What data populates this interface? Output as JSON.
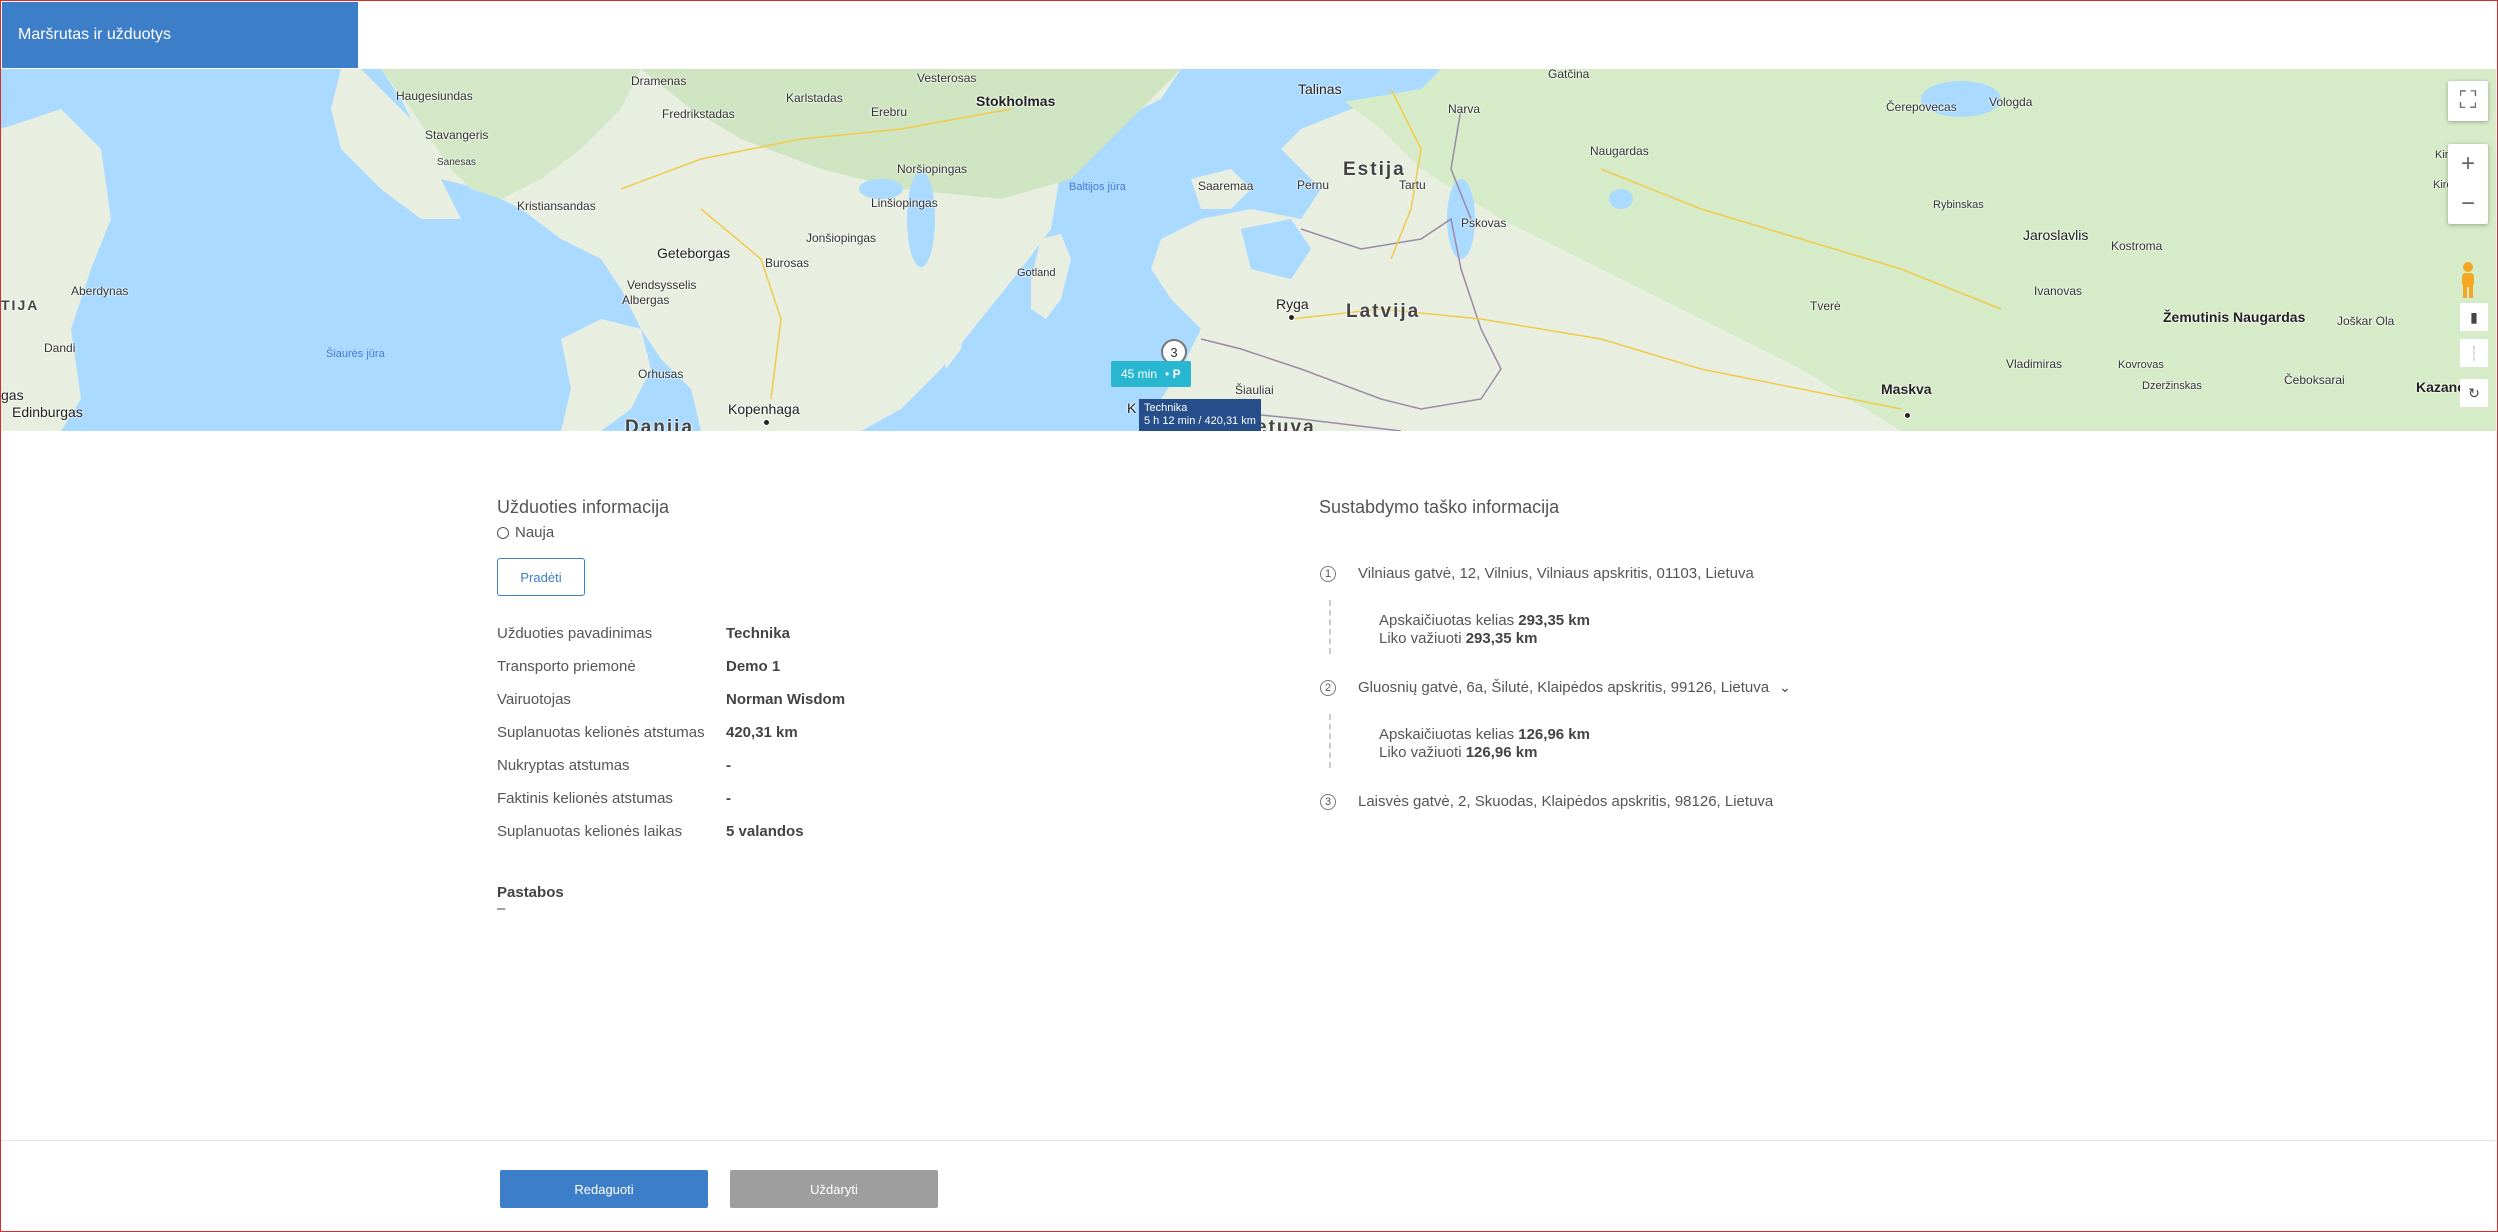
{
  "window": {
    "title": "Maršrutas ir užduotys"
  },
  "map": {
    "countries": [
      "Estija",
      "Latvija",
      "Lietuva",
      "Danija"
    ],
    "seas": [
      "Baltijos jūra",
      "Šiaurės jūra"
    ],
    "places": [
      "Dramenas",
      "Vesterosas",
      "Haugesiundas",
      "Karlstadas",
      "Erebru",
      "Stokholmas",
      "Talinas",
      "Gatčina",
      "Narva",
      "Čerepovecas",
      "Vologda",
      "Fredrikstadas",
      "Stavangeris",
      "Sanesas",
      "Noršiopingas",
      "Linšiopingas",
      "Saaremaa",
      "Pernu",
      "Tartu",
      "Naugardas",
      "Kristiansandas",
      "Rybinskas",
      "Jaroslavlis",
      "Kostroma",
      "Geteborgas",
      "Burosas",
      "Jonšiopingas",
      "Pskovas",
      "Aberdynas",
      "Vendsysselis",
      "Albergas",
      "Gotland",
      "Ryga",
      "Ivanovas",
      "Žemutinis Naugardas",
      "Joškar Ola",
      "Tverė",
      "Dandi",
      "Orhusas",
      "Šiauliai",
      "Vladimiras",
      "Kovrovas",
      "Čeboksarai",
      "Kazanė",
      "Edinburgas",
      "Kopenhaga",
      "Maskva",
      "Dzeržinskas"
    ],
    "route_badge": {
      "time": "45 min",
      "icon_label": "P"
    },
    "stop_marker": "3",
    "vehicle_tag": {
      "name": "Technika",
      "summary": "5 h 12 min / 420,31 km"
    },
    "edge_labels": {
      "left_country": "TIJA",
      "left_city": "gas",
      "vehicle_prefix": "K",
      "country_partial": "etuva",
      "right_top": "Kirc",
      "right_mid": "Kirc",
      "right_city": "Kiro"
    },
    "controls": {
      "fullscreen": "⛶",
      "zoom_in": "+",
      "zoom_out": "−"
    }
  },
  "task_info": {
    "title": "Užduoties informacija",
    "status": "Nauja",
    "start_button": "Pradėti",
    "rows": [
      {
        "label": "Užduoties pavadinimas",
        "value": "Technika"
      },
      {
        "label": "Transporto priemonė",
        "value": "Demo 1"
      },
      {
        "label": "Vairuotojas",
        "value": "Norman Wisdom"
      },
      {
        "label": "Suplanuotas kelionės atstumas",
        "value": "420,31 km"
      },
      {
        "label": "Nukryptas atstumas",
        "value": "-"
      },
      {
        "label": "Faktinis kelionės atstumas",
        "value": "-"
      },
      {
        "label": "Suplanuotas kelionės laikas",
        "value": "5 valandos"
      }
    ],
    "notes_title": "Pastabos",
    "notes_value": "–"
  },
  "stop_info": {
    "title": "Sustabdymo taško informacija",
    "stops": [
      {
        "num": "1",
        "address": "Vilniaus gatvė, 12, Vilnius, Vilniaus apskritis, 01103, Lietuva"
      },
      {
        "num": "2",
        "address": "Gluosnių gatvė, 6a, Šilutė, Klaipėdos apskritis, 99126, Lietuva"
      },
      {
        "num": "3",
        "address": "Laisvės gatvė, 2, Skuodas, Klaipėdos apskritis, 98126, Lietuva"
      }
    ],
    "legs": [
      {
        "calc_label": "Apskaičiuotas kelias",
        "calc_value": "293,35 km",
        "left_label": "Liko važiuoti",
        "left_value": "293,35 km"
      },
      {
        "calc_label": "Apskaičiuotas kelias",
        "calc_value": "126,96 km",
        "left_label": "Liko važiuoti",
        "left_value": "126,96 km"
      }
    ]
  },
  "footer": {
    "edit_button": "Redaguoti",
    "close_button": "Uždaryti"
  }
}
